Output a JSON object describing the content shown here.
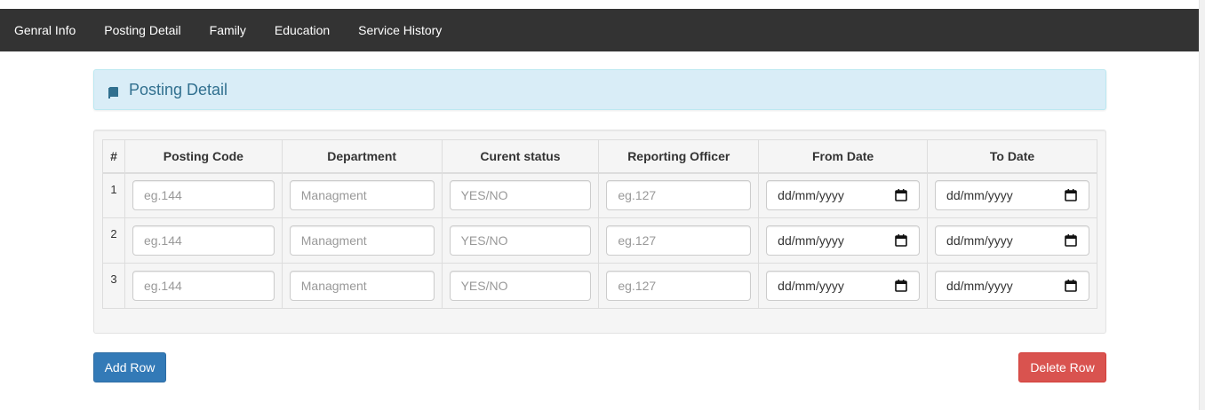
{
  "nav": {
    "items": [
      {
        "label": "Genral Info"
      },
      {
        "label": "Posting Detail"
      },
      {
        "label": "Family"
      },
      {
        "label": "Education"
      },
      {
        "label": "Service History"
      }
    ]
  },
  "panel": {
    "title": "Posting Detail",
    "icon": "book-icon"
  },
  "table": {
    "headers": [
      "#",
      "Posting Code",
      "Department",
      "Curent status",
      "Reporting Officer",
      "From Date",
      "To Date"
    ],
    "rows": [
      {
        "num": "1",
        "posting_code": "eg.144",
        "department": "Managment",
        "status": "YES/NO",
        "officer": "eg.127",
        "from_date": "dd/mm/yyyy",
        "to_date": "dd/mm/yyyy"
      },
      {
        "num": "2",
        "posting_code": "eg.144",
        "department": "Managment",
        "status": "YES/NO",
        "officer": "eg.127",
        "from_date": "dd/mm/yyyy",
        "to_date": "dd/mm/yyyy"
      },
      {
        "num": "3",
        "posting_code": "eg.144",
        "department": "Managment",
        "status": "YES/NO",
        "officer": "eg.127",
        "from_date": "dd/mm/yyyy",
        "to_date": "dd/mm/yyyy"
      }
    ]
  },
  "buttons": {
    "add_row": "Add Row",
    "delete_row": "Delete Row"
  },
  "colors": {
    "navbar": "#333333",
    "panel_bg": "#d9edf7",
    "panel_text": "#31708f",
    "primary": "#337ab7",
    "danger": "#d9534f"
  }
}
